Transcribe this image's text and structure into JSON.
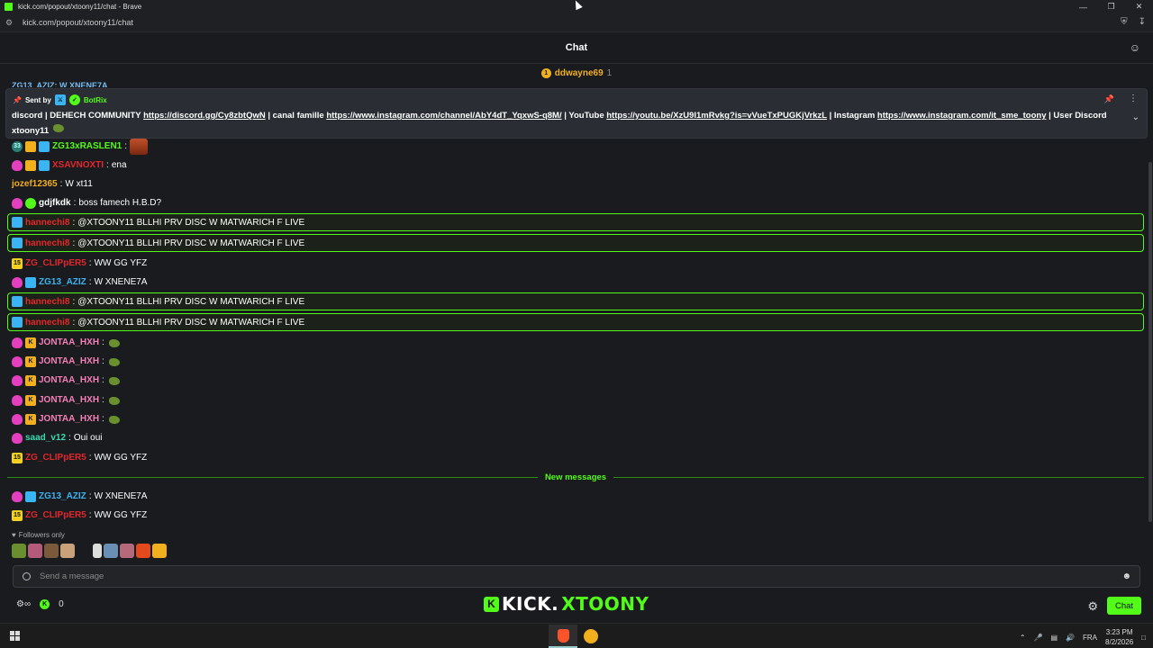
{
  "window": {
    "title": "kick.com/popout/xtoony11/chat - Brave",
    "url": "kick.com/popout/xtoony11/chat"
  },
  "header": {
    "title": "Chat"
  },
  "pinned_user": {
    "name": "ddwayne69",
    "count": "1"
  },
  "ghost_line": "ZG13_AZIZ: W XNENE7A",
  "pinned": {
    "sent_by": "Sent by",
    "bot_name": "BotRix",
    "text_1": "discord | DEHECH COMMUNITY ",
    "link_1": "https://discord.gg/Cy8zbtQwN",
    "text_2": " | canal famille ",
    "link_2": "https://www.instagram.com/channel/AbY4dT_YqxwS-q8M/",
    "text_3": " | YouTube ",
    "link_3": "https://youtu.be/XzU9I1mRvkg?is=vVueTxPUGKjVrkzL",
    "text_4": " | Instagram ",
    "link_4": "https://www.instagram.com/it_sme_toony",
    "text_5": " | User Discord xtoony11"
  },
  "messages": [
    {
      "user": "ZG13xRASLEN1",
      "color": "#53fc18",
      "text": "",
      "badges": [
        "sub33",
        "gold",
        "cyan"
      ],
      "emote": "fire",
      "hl": false
    },
    {
      "user": "XSAVNOXTI",
      "color": "#e5262b",
      "text": "ena",
      "badges": [
        "pink",
        "gold",
        "cyan"
      ],
      "hl": false
    },
    {
      "user": "jozef12365",
      "color": "#f2b01e",
      "text": "W xt11",
      "badges": [],
      "hl": false
    },
    {
      "user": "gdjfkdk",
      "color": "#ffffff",
      "text": "boss famech H.B.D?",
      "badges": [
        "pink",
        "gr"
      ],
      "hl": false
    },
    {
      "user": "hannechi8",
      "color": "#e5262b",
      "text": "@XTOONY11 BLLHI PRV DISC W MATWARICH F LIVE",
      "badges": [
        "cyan"
      ],
      "hl": true
    },
    {
      "user": "hannechi8",
      "color": "#e5262b",
      "text": "@XTOONY11 BLLHI PRV DISC W MATWARICH F LIVE",
      "badges": [
        "cyan"
      ],
      "hl": true
    },
    {
      "user": "ZG_CLIPpER5",
      "color": "#e5262b",
      "text": "WW GG YFZ",
      "badges": [
        "y15"
      ],
      "hl": false
    },
    {
      "user": "ZG13_AZIZ",
      "color": "#3ab4f2",
      "text": "W XNENE7A",
      "badges": [
        "pink",
        "cyan"
      ],
      "hl": false
    },
    {
      "user": "hannechi8",
      "color": "#e5262b",
      "text": "@XTOONY11 BLLHI PRV DISC W MATWARICH F LIVE",
      "badges": [
        "cyan"
      ],
      "hl": true
    },
    {
      "user": "hannechi8",
      "color": "#e5262b",
      "text": "@XTOONY11 BLLHI PRV DISC W MATWARICH F LIVE",
      "badges": [
        "cyan"
      ],
      "hl": true
    },
    {
      "user": "JONTAA_HXH",
      "color": "#f47fb6",
      "text": "",
      "badges": [
        "pink",
        "k"
      ],
      "emote": "frog",
      "hl": false
    },
    {
      "user": "JONTAA_HXH",
      "color": "#f47fb6",
      "text": "",
      "badges": [
        "pink",
        "k"
      ],
      "emote": "frog",
      "hl": false
    },
    {
      "user": "JONTAA_HXH",
      "color": "#f47fb6",
      "text": "",
      "badges": [
        "pink",
        "k"
      ],
      "emote": "frog",
      "hl": false
    },
    {
      "user": "JONTAA_HXH",
      "color": "#f47fb6",
      "text": "",
      "badges": [
        "pink",
        "k"
      ],
      "emote": "frog",
      "hl": false
    },
    {
      "user": "JONTAA_HXH",
      "color": "#f47fb6",
      "text": "",
      "badges": [
        "pink",
        "k"
      ],
      "emote": "frog",
      "hl": false
    },
    {
      "user": "saad_v12",
      "color": "#3ad9b0",
      "text": "Oui oui",
      "badges": [
        "pink"
      ],
      "hl": false
    },
    {
      "user": "ZG_CLIPpER5",
      "color": "#e5262b",
      "text": "WW GG YFZ",
      "badges": [
        "y15"
      ],
      "hl": false
    }
  ],
  "divider": "New messages",
  "new_messages": [
    {
      "user": "ZG13_AZIZ",
      "color": "#3ab4f2",
      "text": "W XNENE7A",
      "badges": [
        "pink",
        "cyan"
      ],
      "hl": false
    },
    {
      "user": "ZG_CLIPpER5",
      "color": "#e5262b",
      "text": "WW GG YFZ",
      "badges": [
        "y15"
      ],
      "hl": false
    }
  ],
  "followers_only": "Followers only",
  "input": {
    "placeholder": "Send a message"
  },
  "footer": {
    "kicks": "0",
    "logo_a": "KICK.",
    "logo_b": "XTOONY",
    "chat_button": "Chat"
  },
  "taskbar": {
    "lang": "FRA",
    "time": "3:23 PM",
    "date": "8/2/2026"
  },
  "badge_text": {
    "sub33": "33",
    "y15": "15",
    "k": "K",
    "gr": "",
    "pink": "",
    "gold": "",
    "cyan": ""
  },
  "colors": {
    "accent": "#53fc18",
    "bg": "#191b1f"
  }
}
